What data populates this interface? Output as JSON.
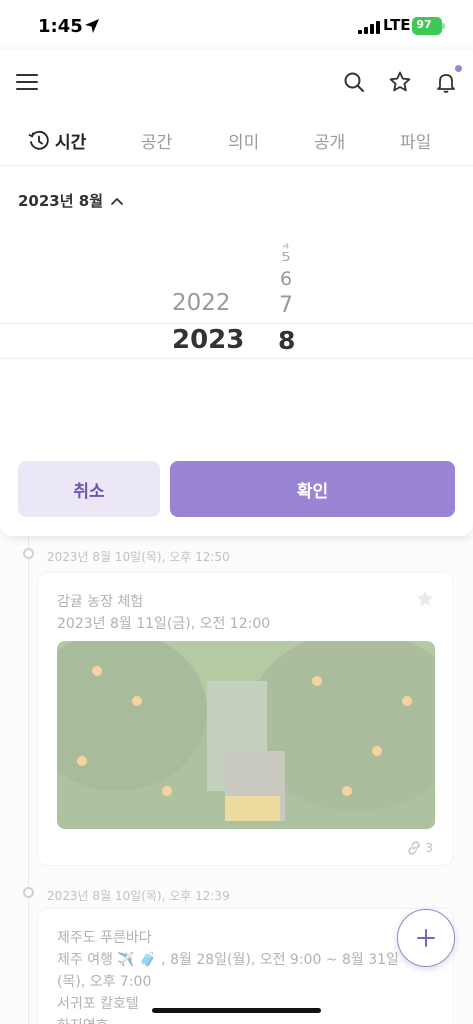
{
  "status_bar": {
    "time": "1:45",
    "network": "LTE",
    "battery": "97"
  },
  "header": {
    "icons": [
      "menu-icon",
      "search-icon",
      "star-icon",
      "bell-icon"
    ]
  },
  "tabs": [
    {
      "label": "시간",
      "active": true
    },
    {
      "label": "공간",
      "active": false
    },
    {
      "label": "의미",
      "active": false
    },
    {
      "label": "공개",
      "active": false
    },
    {
      "label": "파일",
      "active": false
    }
  ],
  "date_toggle": "2023년 8월",
  "picker": {
    "years": [
      "2022",
      "2023"
    ],
    "selected_year": "2023",
    "months": [
      "4",
      "5",
      "6",
      "7",
      "8"
    ],
    "selected_month": "8"
  },
  "buttons": {
    "cancel": "취소",
    "confirm": "확인"
  },
  "timeline": [
    {
      "date": "2023년 8월 10일(목), 오후 12:50",
      "title": "감귤 농장 체험",
      "subtitle": "2023년 8월 11일(금), 오전 12:00",
      "link_count": "3"
    },
    {
      "date": "2023년 8월 10일(목), 오후 12:39",
      "title": "제주도 푸른바다",
      "line2": "제주 여행 ✈️ 🧳 , 8월 28일(월), 오전 9:00 ~ 8월 31일",
      "line3": "(목), 오후 7:00",
      "line4": "서귀포 칼호텔",
      "line5": "하지연호"
    }
  ],
  "colors": {
    "accent": "#9a84d4",
    "accent_light": "#ebe7f6",
    "battery": "#3ec957"
  }
}
